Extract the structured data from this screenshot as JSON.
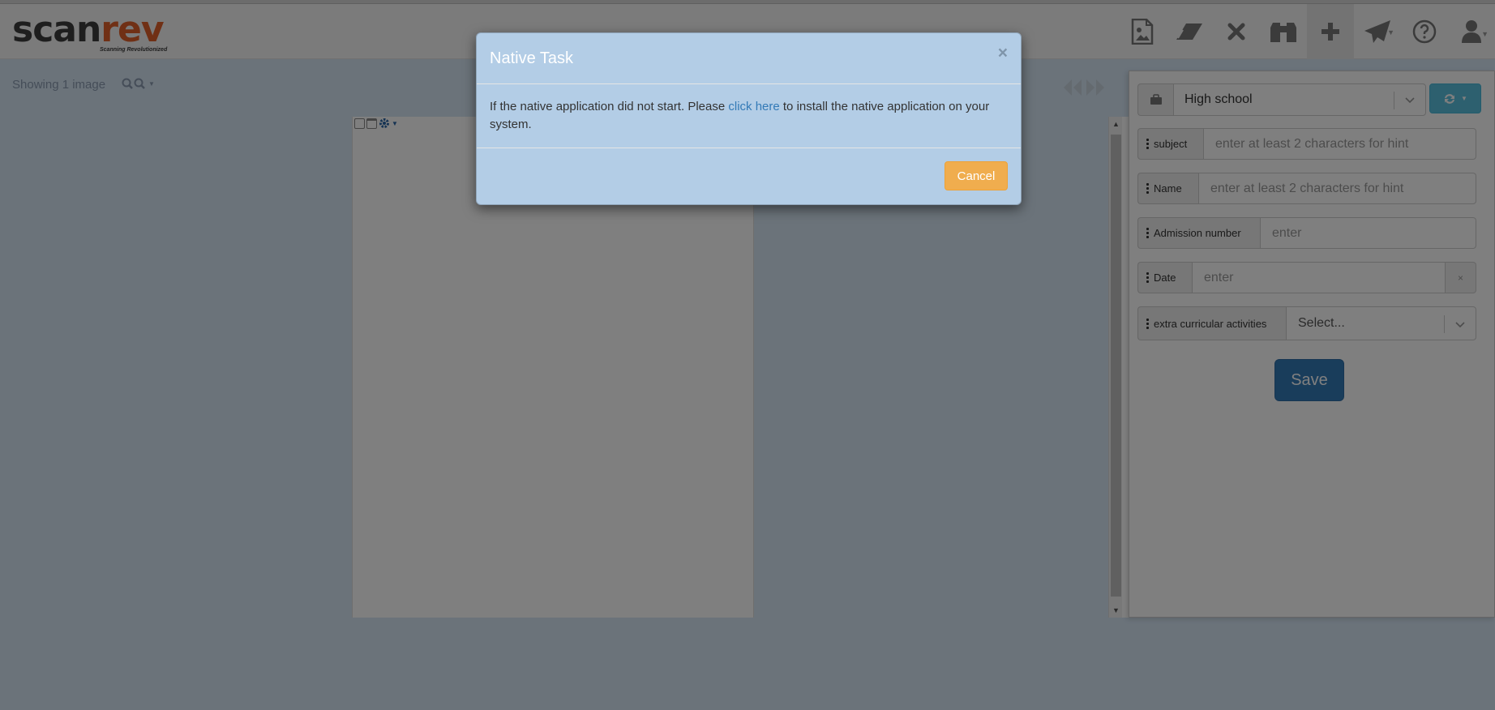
{
  "app": {
    "logo_main": "scan",
    "logo_accent": "rev",
    "tagline": "Scanning Revolutionized"
  },
  "navbar": {
    "icons": [
      "document-image-icon",
      "eraser-icon",
      "close-icon",
      "binoculars-icon",
      "plus-icon",
      "send-icon",
      "help-icon",
      "user-icon"
    ]
  },
  "toolbar": {
    "showing_text": "Showing 1 image"
  },
  "form": {
    "document_type": "High school",
    "fields": [
      {
        "label": "subject",
        "placeholder": "enter at least 2 characters for hint"
      },
      {
        "label": "Name",
        "placeholder": "enter at least 2 characters for hint"
      },
      {
        "label": "Admission number",
        "placeholder": "enter"
      },
      {
        "label": "Date",
        "placeholder": "enter",
        "clear": "×"
      },
      {
        "label": "extra curricular activities",
        "placeholder": "Select..."
      }
    ],
    "save_label": "Save"
  },
  "modal": {
    "title": "Native Task",
    "close": "×",
    "body_before": "If the native application did not start. Please ",
    "link_text": "click here",
    "body_after": " to install the native application on your system.",
    "cancel_label": "Cancel"
  },
  "colors": {
    "brand_dark": "#3d3d3d",
    "brand_accent": "#e0612a",
    "primary": "#337ab7",
    "info": "#5bc0de",
    "warning": "#f0ad4e"
  }
}
